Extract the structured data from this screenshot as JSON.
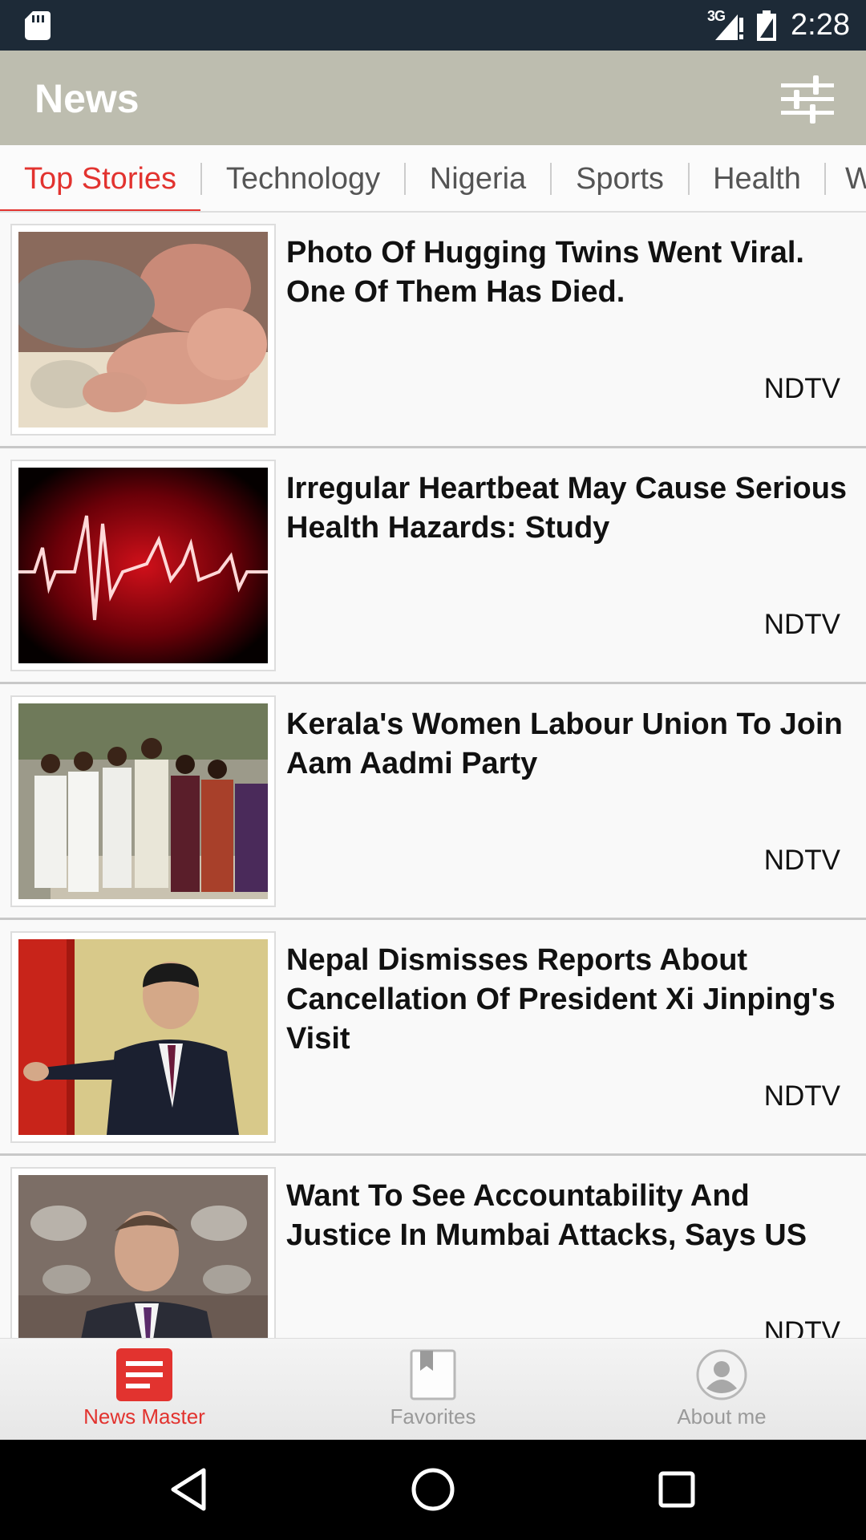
{
  "status_bar": {
    "network": "3G",
    "time": "2:28"
  },
  "app_bar": {
    "title": "News"
  },
  "tabs": [
    {
      "label": "Top Stories",
      "active": true
    },
    {
      "label": "Technology",
      "active": false
    },
    {
      "label": "Nigeria",
      "active": false
    },
    {
      "label": "Sports",
      "active": false
    },
    {
      "label": "Health",
      "active": false
    },
    {
      "label": "W",
      "active": false
    }
  ],
  "articles": [
    {
      "headline": "Photo Of Hugging Twins Went Viral. One Of Them Has Died.",
      "source": "NDTV",
      "thumb": "twins-photo"
    },
    {
      "headline": "Irregular Heartbeat May Cause Serious Health Hazards: Study",
      "source": "NDTV",
      "thumb": "heartbeat-help-photo"
    },
    {
      "headline": "Kerala's Women Labour Union To Join Aam Aadmi Party",
      "source": "NDTV",
      "thumb": "group-photo"
    },
    {
      "headline": "Nepal Dismisses Reports About Cancellation Of President Xi Jinping's Visit",
      "source": "NDTV",
      "thumb": "xi-jinping-photo"
    },
    {
      "headline": "Want To See Accountability And Justice In Mumbai Attacks, Says US",
      "source": "NDTV",
      "thumb": "spokesperson-photo"
    }
  ],
  "bottom_nav": [
    {
      "label": "News Master",
      "icon": "news-icon",
      "active": true
    },
    {
      "label": "Favorites",
      "icon": "bookmark-icon",
      "active": false
    },
    {
      "label": "About me",
      "icon": "person-icon",
      "active": false
    }
  ],
  "colors": {
    "accent": "#e2332f",
    "app_bar": "#bdbdaf",
    "status_bar": "#1d2a37"
  }
}
